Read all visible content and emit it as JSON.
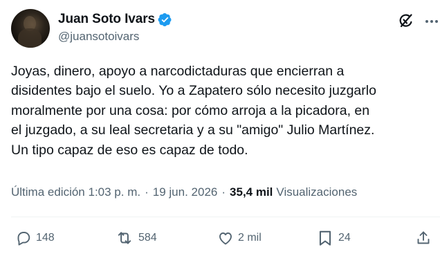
{
  "author": {
    "display_name": "Juan Soto Ivars",
    "handle": "@juansotoivars",
    "verified": true
  },
  "tweet": {
    "lines": [
      "Joyas, dinero, apoyo a narcodictaduras que encierran a",
      "disidentes bajo el suelo. Yo a Zapatero sólo necesito juzgarlo",
      "moralmente por una cosa: por cómo arroja a la picadora, en",
      "el juzgado, a su leal secretaria y a su \"amigo\" Julio Martínez.",
      "Un tipo capaz de eso es capaz de todo."
    ]
  },
  "meta": {
    "edited_label": "Última edición 1:03 p. m.",
    "separator": "·",
    "date": "19 jun. 2026",
    "views_count": "35,4 mil",
    "views_label": "Visualizaciones"
  },
  "actions": {
    "replies": "148",
    "reposts": "584",
    "likes": "2 mil",
    "bookmarks": "24"
  },
  "icons": {
    "verified": "verified-badge-icon",
    "grok": "grok-icon",
    "more": "more-icon",
    "reply": "reply-icon",
    "repost": "repost-icon",
    "like": "like-icon",
    "bookmark": "bookmark-icon",
    "share": "share-icon"
  },
  "colors": {
    "text_primary": "#0f1419",
    "text_secondary": "#536471",
    "verified_blue": "#1d9bf0"
  }
}
